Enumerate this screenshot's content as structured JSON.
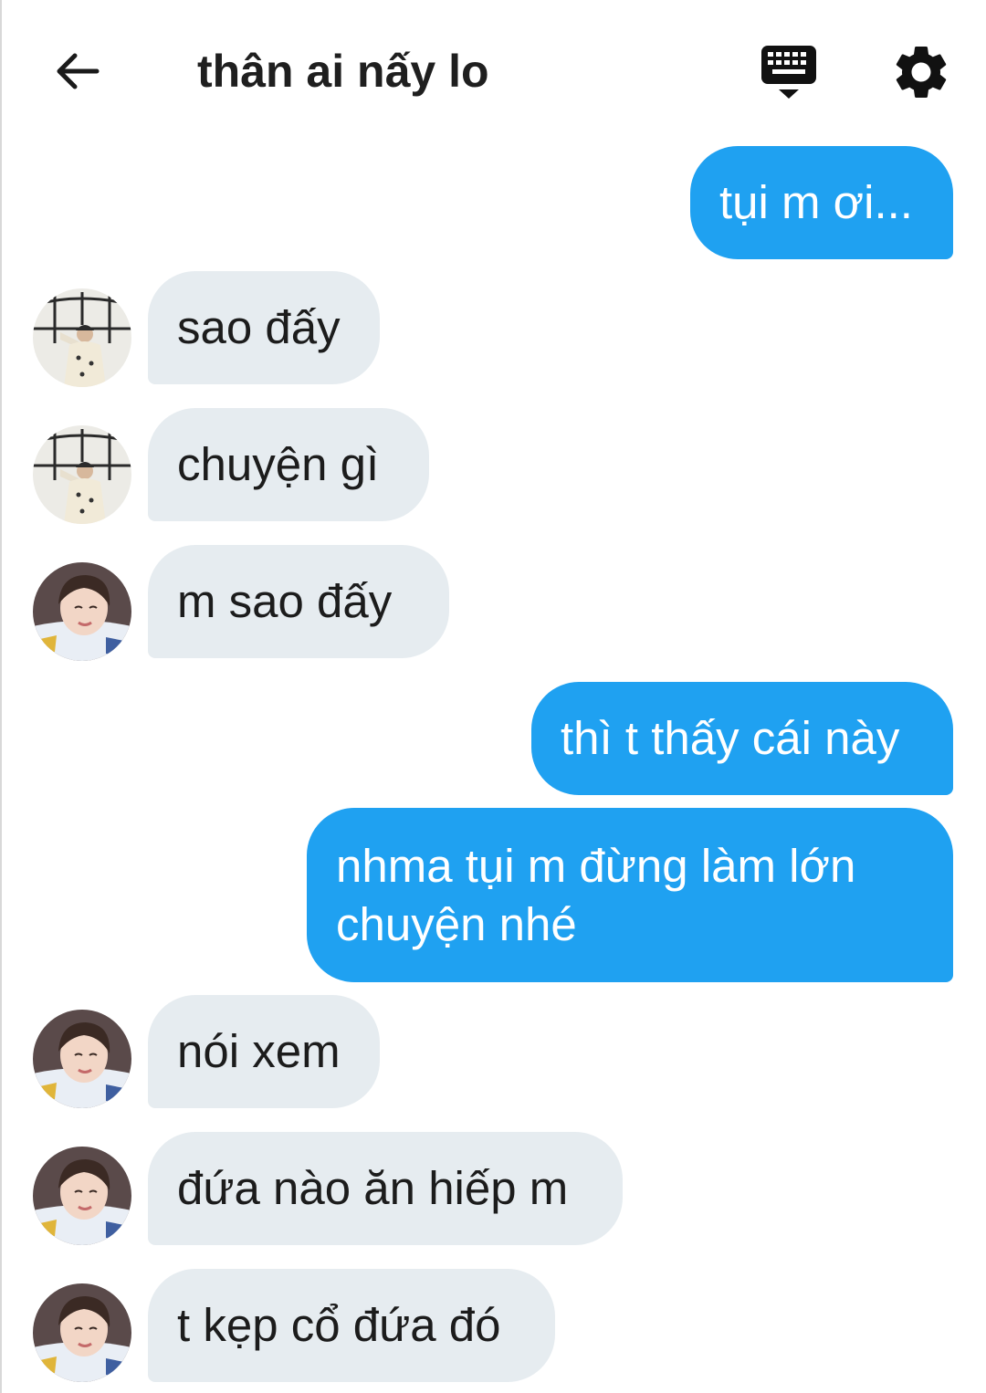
{
  "header": {
    "title": "thân ai nấy lo",
    "back_icon": "back-arrow-icon",
    "keyboard_icon": "keyboard-icon",
    "settings_icon": "gear-icon"
  },
  "colors": {
    "outgoing_bubble": "#1fa1f1",
    "incoming_bubble": "#e6ecf0",
    "text": "#1c1c1c"
  },
  "messages": [
    {
      "direction": "outgoing",
      "text": "tụi m ơi..."
    },
    {
      "direction": "incoming",
      "sender_avatar": "avatar-user-a",
      "text": "sao đấy"
    },
    {
      "direction": "incoming",
      "sender_avatar": "avatar-user-a",
      "text": "chuyện gì"
    },
    {
      "direction": "incoming",
      "sender_avatar": "avatar-user-b",
      "text": "m sao đấy"
    },
    {
      "direction": "outgoing",
      "text": "thì t thấy cái này"
    },
    {
      "direction": "outgoing",
      "text": "nhma tụi m đừng làm lớn chuyện nhé"
    },
    {
      "direction": "incoming",
      "sender_avatar": "avatar-user-b",
      "text": "nói xem"
    },
    {
      "direction": "incoming",
      "sender_avatar": "avatar-user-b",
      "text": "đứa nào ăn hiếp m"
    },
    {
      "direction": "incoming",
      "sender_avatar": "avatar-user-b",
      "text": "t kẹp cổ đứa đó"
    }
  ]
}
